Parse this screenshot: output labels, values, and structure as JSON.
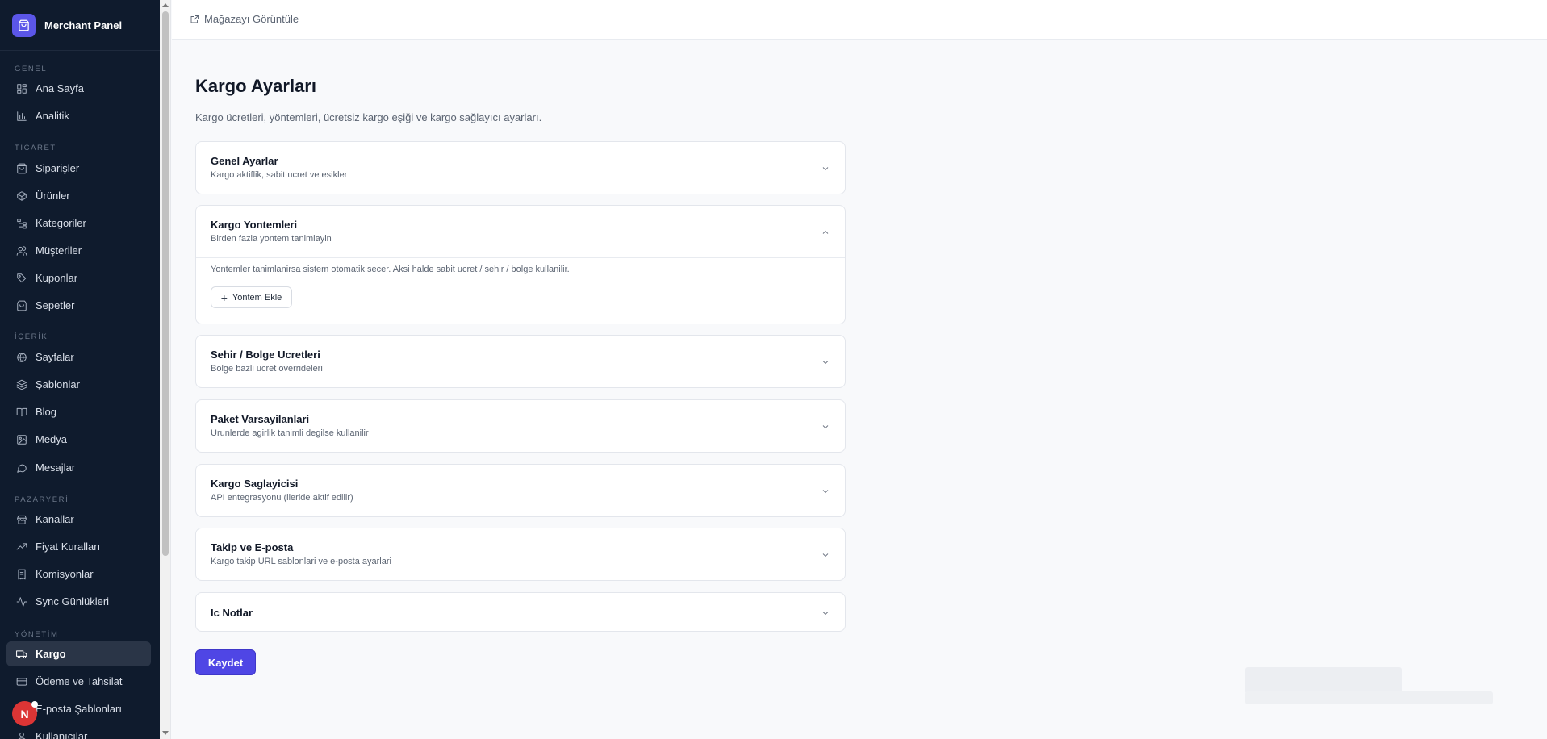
{
  "app": {
    "brand_name": "Merchant Panel",
    "accent_color": "#4f46e5",
    "sidebar_bg": "#0f1b2d"
  },
  "sidebar": {
    "sections": [
      {
        "label": "GENEL",
        "items": [
          {
            "label": "Ana Sayfa",
            "icon": "dashboard-icon"
          },
          {
            "label": "Analitik",
            "icon": "bar-chart-icon"
          }
        ]
      },
      {
        "label": "TİCARET",
        "items": [
          {
            "label": "Siparişler",
            "icon": "shopping-bag-icon"
          },
          {
            "label": "Ürünler",
            "icon": "package-icon"
          },
          {
            "label": "Kategoriler",
            "icon": "tree-icon"
          },
          {
            "label": "Müşteriler",
            "icon": "users-icon"
          },
          {
            "label": "Kuponlar",
            "icon": "tag-icon"
          },
          {
            "label": "Sepetler",
            "icon": "basket-icon"
          }
        ]
      },
      {
        "label": "İÇERİK",
        "items": [
          {
            "label": "Sayfalar",
            "icon": "globe-icon"
          },
          {
            "label": "Şablonlar",
            "icon": "layers-icon"
          },
          {
            "label": "Blog",
            "icon": "book-icon"
          },
          {
            "label": "Medya",
            "icon": "image-icon"
          },
          {
            "label": "Mesajlar",
            "icon": "message-icon"
          }
        ]
      },
      {
        "label": "PAZARYERİ",
        "items": [
          {
            "label": "Kanallar",
            "icon": "store-icon"
          },
          {
            "label": "Fiyat Kuralları",
            "icon": "trending-up-icon"
          },
          {
            "label": "Komisyonlar",
            "icon": "receipt-icon"
          },
          {
            "label": "Sync Günlükleri",
            "icon": "activity-icon"
          }
        ]
      },
      {
        "label": "YÖNETİM",
        "items": [
          {
            "label": "Kargo",
            "icon": "truck-icon",
            "active": true
          },
          {
            "label": "Ödeme ve Tahsilat",
            "icon": "credit-card-icon"
          },
          {
            "label": "E-posta Şablonları",
            "icon": "mail-icon"
          },
          {
            "label": "Kullanıcılar",
            "icon": "user-icon"
          }
        ]
      }
    ],
    "avatar_initial": "N"
  },
  "topbar": {
    "view_store": "Mağazayı Görüntüle"
  },
  "page": {
    "title": "Kargo Ayarları",
    "subtitle": "Kargo ücretleri, yöntemleri, ücretsiz kargo eşiği ve kargo sağlayıcı ayarları."
  },
  "cards": [
    {
      "title": "Genel Ayarlar",
      "desc": "Kargo aktiflik, sabit ucret ve esikler",
      "expanded": false
    },
    {
      "title": "Kargo Yontemleri",
      "desc": "Birden fazla yontem tanimlayin",
      "expanded": true,
      "note": "Yontemler tanimlanirsa sistem otomatik secer. Aksi halde sabit ucret / sehir / bolge kullanilir.",
      "add_button": "Yontem Ekle"
    },
    {
      "title": "Sehir / Bolge Ucretleri",
      "desc": "Bolge bazli ucret overrideleri",
      "expanded": false
    },
    {
      "title": "Paket Varsayilanlari",
      "desc": "Urunlerde agirlik tanimli degilse kullanilir",
      "expanded": false
    },
    {
      "title": "Kargo Saglayicisi",
      "desc": "API entegrasyonu (ileride aktif edilir)",
      "expanded": false
    },
    {
      "title": "Takip ve E-posta",
      "desc": "Kargo takip URL sablonlari ve e-posta ayarlari",
      "expanded": false
    },
    {
      "title": "Ic Notlar",
      "expanded": false
    }
  ],
  "actions": {
    "save": "Kaydet"
  }
}
